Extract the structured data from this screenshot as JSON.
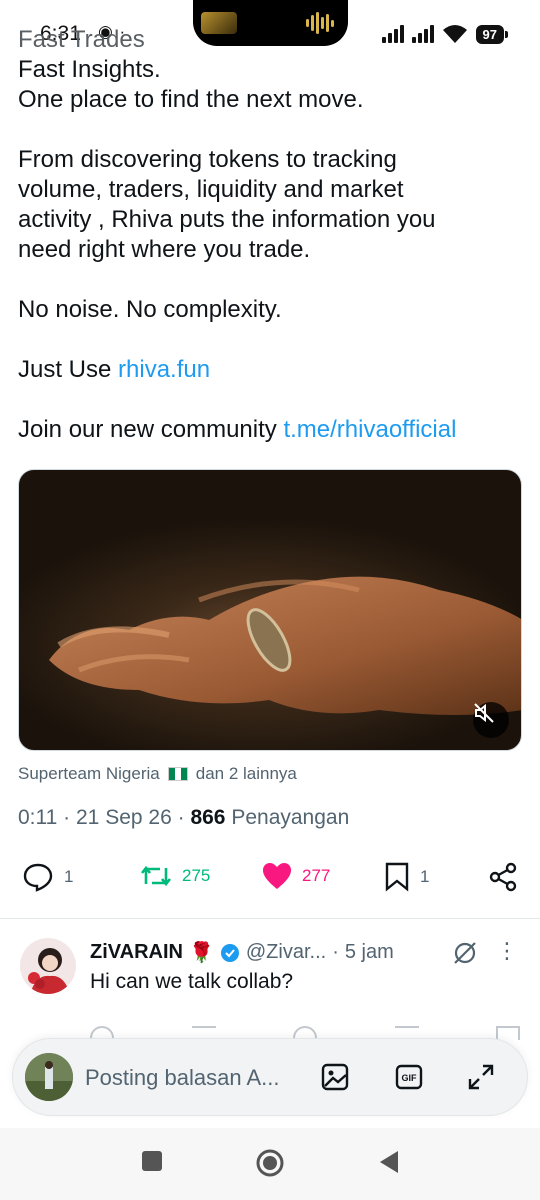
{
  "status_bar": {
    "time": "6:31",
    "extra_icons": "◉ ·",
    "battery": "97"
  },
  "tweet": {
    "header_partial": "Fast Trades",
    "line1": "Fast Insights.",
    "line2": "One place to find the next move.",
    "para2": [
      "From discovering tokens to tracking",
      "volume, traders, liquidity and market",
      "activity , Rhiva puts the information you",
      "need right where you trade."
    ],
    "line_noise": "No noise. No complexity.",
    "just_use_prefix": "Just Use ",
    "just_use_link": "rhiva.fun",
    "join_prefix": "Join our new community ",
    "join_link": "t.me/rhivaofficial",
    "social_context_prefix": "Superteam Nigeria",
    "social_context_suffix": "dan 2 lainnya",
    "time": "0:11",
    "date": "21 Sep 26",
    "views": "866",
    "views_label": "Penayangan",
    "replies": "1",
    "retweets": "275",
    "likes": "277",
    "bookmarks": "1",
    "link_color": "#1d9bf0",
    "retweet_color": "#00ba7c",
    "like_color": "#f91880"
  },
  "reply": {
    "name": "ZiVARAIN",
    "name_emoji": "🌹",
    "handle": "@Zivar...",
    "time": "5 jam",
    "text": "Hi can we talk collab?"
  },
  "compose": {
    "placeholder": "Posting balasan A..."
  },
  "icons": {
    "reply": "reply-icon",
    "retweet": "retweet-icon",
    "like": "heart-icon",
    "bookmark": "bookmark-icon",
    "share": "share-icon",
    "image": "image-icon",
    "gif": "gif-icon",
    "expand": "expand-icon",
    "mute": "mute-icon"
  }
}
